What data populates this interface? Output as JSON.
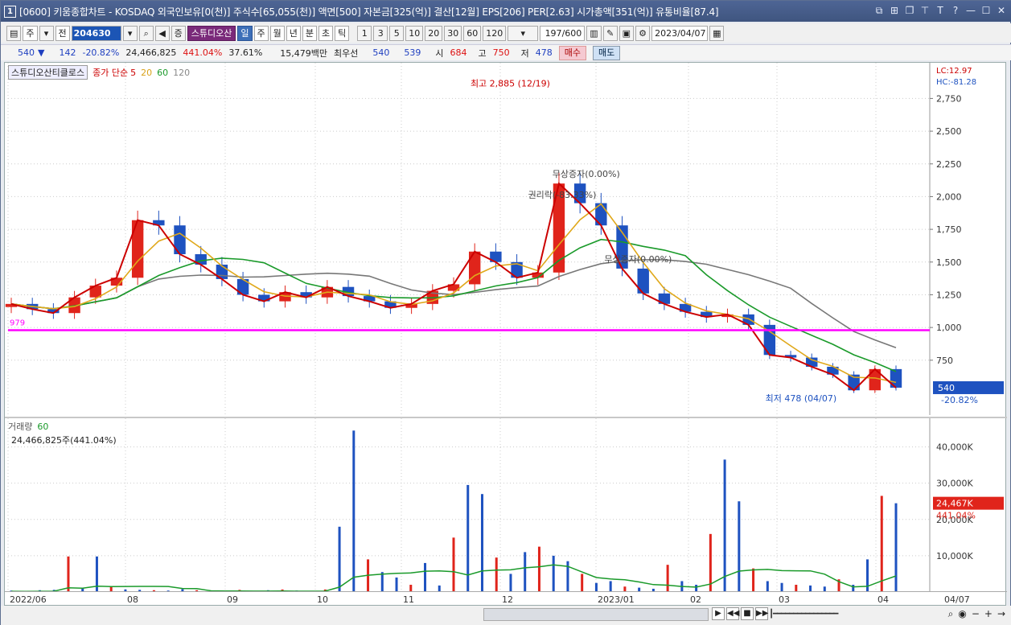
{
  "title": {
    "number": "1",
    "text": "[0600] 키움종합차트 - KOSDAQ 외국인보유[0(천)] 주식수[65,055(천)] 액면[500] 자본금[325(억)] 결산[12월] EPS[206] PER[2.63] 시가총액[351(억)] 유통비율[87.4]"
  },
  "toolbar": {
    "period": "주",
    "prev": "전",
    "code": "204630",
    "stock_name": "스튜디오산",
    "tabs": [
      "일",
      "주",
      "월",
      "년",
      "분",
      "초",
      "틱"
    ],
    "active_tab": "일",
    "ticks": [
      "1",
      "3",
      "5",
      "10",
      "20",
      "30",
      "60",
      "120"
    ],
    "count": "197",
    "count_max": "/600",
    "date": "2023/04/07"
  },
  "quote": {
    "price": "540",
    "direction": "▼",
    "change": "142",
    "change_pct": "-20.82%",
    "volume": "24,466,825",
    "vol_ratio": "441.04%",
    "turnover": "37.61%",
    "amount": "15,479백만",
    "ask_label": "최우선",
    "ask": "540",
    "bid": "539",
    "open_label": "시",
    "open": "684",
    "high_label": "고",
    "high": "750",
    "low_label": "저",
    "low": "478",
    "sell": "매수",
    "buy": "매도"
  },
  "legend": {
    "stock_box": "스튜디오산티클로스",
    "close_label": "종가 단순",
    "ma": [
      "5",
      "20",
      "60",
      "120"
    ],
    "volume_label": "거래량",
    "volume_ma": "60",
    "volume_today": "24,466,825주(441.04%)",
    "lc": "LC:12.97",
    "hc": "HC:-81.28"
  },
  "annotations": {
    "high": "최고 2,885 (12/19)",
    "low": "최저 478 (04/07)",
    "rights": "권리락(-83.33%)",
    "free1": "무상증자(0.00%)",
    "free2": "무상증자(0.00%)",
    "hline": "979",
    "price_tag": "540",
    "price_tag_pct": "-20.82%",
    "vol_tag": "24,467K",
    "vol_tag_pct": "441.04%"
  },
  "colors": {
    "up": "#e0241b",
    "down": "#1e52c0",
    "ma5": "#cc0000",
    "ma20": "#e0a81a",
    "ma60": "#1a9a2a",
    "ma120": "#777777",
    "hline": "#ff00ff"
  },
  "chart_data": [
    {
      "type": "candlestick",
      "title": "",
      "y_ticks": [
        "2,750",
        "2,500",
        "2,250",
        "2,000",
        "1,750",
        "1,500",
        "1,250",
        "1,000",
        "750"
      ],
      "ylim": [
        380,
        2900
      ],
      "x_ticks": [
        "2022/06",
        "08",
        "09",
        "10",
        "11",
        "12",
        "2023/01",
        "02",
        "03",
        "04"
      ],
      "x_right": "04/07",
      "series_close": [
        {
          "date": "06",
          "close": 1180
        },
        {
          "date": "06",
          "close": 1140
        },
        {
          "date": "07",
          "close": 1110
        },
        {
          "date": "07",
          "close": 1230
        },
        {
          "date": "07",
          "close": 1320
        },
        {
          "date": "07",
          "close": 1380
        },
        {
          "date": "08",
          "close": 1820
        },
        {
          "date": "08",
          "close": 1780
        },
        {
          "date": "08",
          "close": 1560
        },
        {
          "date": "08",
          "close": 1480
        },
        {
          "date": "09",
          "close": 1370
        },
        {
          "date": "09",
          "close": 1250
        },
        {
          "date": "09",
          "close": 1200
        },
        {
          "date": "09",
          "close": 1270
        },
        {
          "date": "10",
          "close": 1230
        },
        {
          "date": "10",
          "close": 1310
        },
        {
          "date": "10",
          "close": 1240
        },
        {
          "date": "10",
          "close": 1200
        },
        {
          "date": "11",
          "close": 1150
        },
        {
          "date": "11",
          "close": 1180
        },
        {
          "date": "11",
          "close": 1280
        },
        {
          "date": "11",
          "close": 1330
        },
        {
          "date": "12",
          "close": 1580
        },
        {
          "date": "12",
          "close": 1500
        },
        {
          "date": "12",
          "close": 1380
        },
        {
          "date": "12",
          "close": 1420
        },
        {
          "date": "12",
          "close": 2100
        },
        {
          "date": "12",
          "close": 1950
        },
        {
          "date": "01",
          "close": 1780
        },
        {
          "date": "01",
          "close": 1450
        },
        {
          "date": "01",
          "close": 1260
        },
        {
          "date": "01",
          "close": 1180
        },
        {
          "date": "02",
          "close": 1120
        },
        {
          "date": "02",
          "close": 1080
        },
        {
          "date": "02",
          "close": 1100
        },
        {
          "date": "02",
          "close": 1020
        },
        {
          "date": "03",
          "close": 790
        },
        {
          "date": "03",
          "close": 770
        },
        {
          "date": "03",
          "close": 700
        },
        {
          "date": "03",
          "close": 640
        },
        {
          "date": "04",
          "close": 520
        },
        {
          "date": "04",
          "close": 682
        },
        {
          "date": "04",
          "close": 540
        }
      ]
    },
    {
      "type": "bar",
      "title": "",
      "y_ticks": [
        "40,000K",
        "30,000K",
        "20,000K",
        "10,000K"
      ],
      "ylim": [
        0,
        47000
      ],
      "values_k": [
        400,
        300,
        500,
        600,
        9800,
        1200,
        9800,
        1500,
        700,
        600,
        500,
        400,
        800,
        500,
        300,
        400,
        600,
        300,
        500,
        700,
        400,
        300,
        700,
        18000,
        44500,
        9000,
        5500,
        4000,
        2000,
        8000,
        1800,
        15000,
        29500,
        27000,
        9500,
        5000,
        11000,
        12500,
        10000,
        8500,
        5000,
        2500,
        3000,
        1500,
        1200,
        900,
        7500,
        3000,
        2000,
        16000,
        36500,
        25000,
        6500,
        3000,
        2500,
        2000,
        1800,
        1500,
        3500,
        2000,
        9000,
        26500,
        24467
      ]
    }
  ]
}
